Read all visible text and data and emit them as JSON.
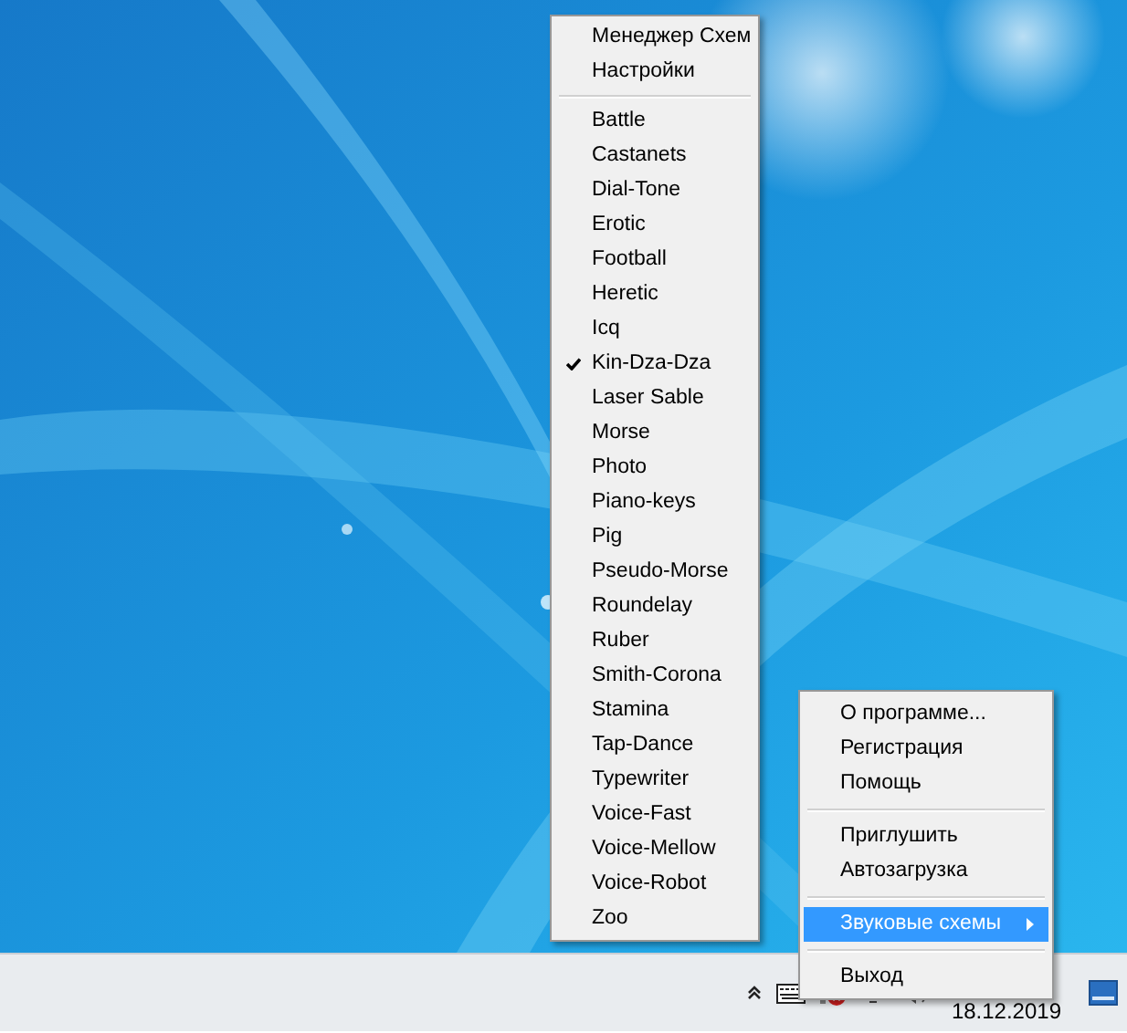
{
  "schemes_menu": {
    "items": [
      {
        "kind": "item",
        "label": "Менеджер Схем",
        "checked": false
      },
      {
        "kind": "item",
        "label": "Настройки",
        "checked": false
      },
      {
        "kind": "separator"
      },
      {
        "kind": "item",
        "label": "Battle",
        "checked": false
      },
      {
        "kind": "item",
        "label": "Castanets",
        "checked": false
      },
      {
        "kind": "item",
        "label": "Dial-Tone",
        "checked": false
      },
      {
        "kind": "item",
        "label": "Erotic",
        "checked": false
      },
      {
        "kind": "item",
        "label": "Football",
        "checked": false
      },
      {
        "kind": "item",
        "label": "Heretic",
        "checked": false
      },
      {
        "kind": "item",
        "label": "Icq",
        "checked": false
      },
      {
        "kind": "item",
        "label": "Kin-Dza-Dza",
        "checked": true
      },
      {
        "kind": "item",
        "label": "Laser Sable",
        "checked": false
      },
      {
        "kind": "item",
        "label": "Morse",
        "checked": false
      },
      {
        "kind": "item",
        "label": "Photo",
        "checked": false
      },
      {
        "kind": "item",
        "label": "Piano-keys",
        "checked": false
      },
      {
        "kind": "item",
        "label": "Pig",
        "checked": false
      },
      {
        "kind": "item",
        "label": "Pseudo-Morse",
        "checked": false
      },
      {
        "kind": "item",
        "label": "Roundelay",
        "checked": false
      },
      {
        "kind": "item",
        "label": "Ruber",
        "checked": false
      },
      {
        "kind": "item",
        "label": "Smith-Corona",
        "checked": false
      },
      {
        "kind": "item",
        "label": "Stamina",
        "checked": false
      },
      {
        "kind": "item",
        "label": "Tap-Dance",
        "checked": false
      },
      {
        "kind": "item",
        "label": "Typewriter",
        "checked": false
      },
      {
        "kind": "item",
        "label": "Voice-Fast",
        "checked": false
      },
      {
        "kind": "item",
        "label": "Voice-Mellow",
        "checked": false
      },
      {
        "kind": "item",
        "label": "Voice-Robot",
        "checked": false
      },
      {
        "kind": "item",
        "label": "Zoo",
        "checked": false
      }
    ]
  },
  "tray_menu": {
    "items": [
      {
        "kind": "item",
        "label": "О программе...",
        "selected": false,
        "submenu": false
      },
      {
        "kind": "item",
        "label": "Регистрация",
        "selected": false,
        "submenu": false
      },
      {
        "kind": "item",
        "label": "Помощь",
        "selected": false,
        "submenu": false
      },
      {
        "kind": "separator"
      },
      {
        "kind": "item",
        "label": "Приглушить",
        "selected": false,
        "submenu": false
      },
      {
        "kind": "item",
        "label": "Автозагрузка",
        "selected": false,
        "submenu": false
      },
      {
        "kind": "separator"
      },
      {
        "kind": "item",
        "label": "Звуковые схемы",
        "selected": true,
        "submenu": true
      },
      {
        "kind": "separator"
      },
      {
        "kind": "item",
        "label": "Выход",
        "selected": false,
        "submenu": false
      }
    ]
  },
  "taskbar": {
    "date": "18.12.2019"
  }
}
